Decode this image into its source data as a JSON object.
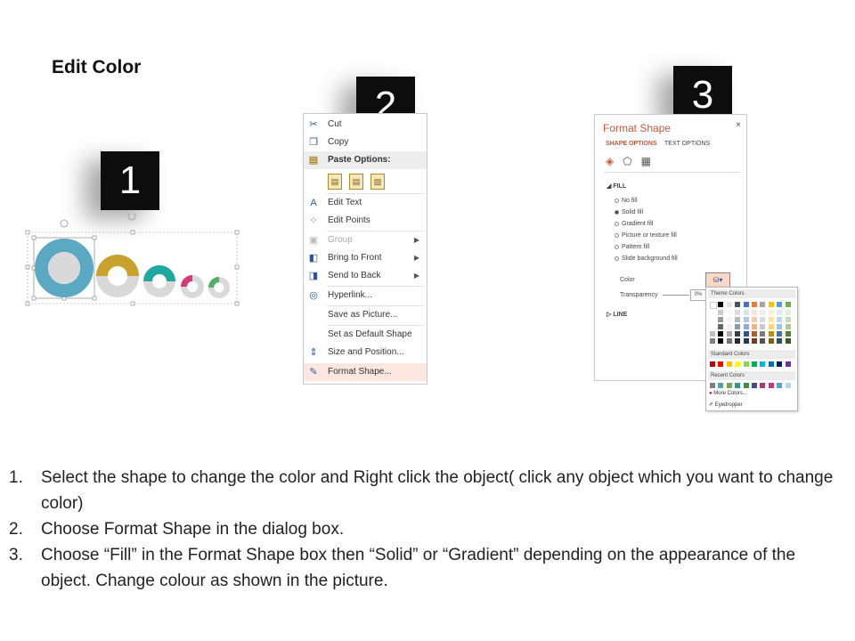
{
  "title": "Edit Color",
  "steps": [
    "1",
    "2",
    "3"
  ],
  "context_menu": {
    "items": [
      {
        "label": "Cut",
        "icon": "scissors-icon",
        "glyph": "✂"
      },
      {
        "label": "Copy",
        "icon": "copy-icon",
        "glyph": "❐"
      },
      {
        "label": "Paste Options:",
        "icon": "paste-icon",
        "glyph": "📋"
      },
      {
        "label": "Edit Text",
        "icon": "edit-text-icon",
        "glyph": "A"
      },
      {
        "label": "Edit Points",
        "icon": "edit-points-icon",
        "glyph": "⁘"
      },
      {
        "label": "Group",
        "icon": "group-icon",
        "glyph": "▣"
      },
      {
        "label": "Bring to Front",
        "icon": "bring-to-front-icon",
        "glyph": "◧"
      },
      {
        "label": "Send to Back",
        "icon": "send-to-back-icon",
        "glyph": "◨"
      },
      {
        "label": "Hyperlink...",
        "icon": "hyperlink-icon",
        "glyph": "🌐"
      },
      {
        "label": "Save as Picture...",
        "icon": "",
        "glyph": ""
      },
      {
        "label": "Set as Default Shape",
        "icon": "",
        "glyph": ""
      },
      {
        "label": "Size and Position...",
        "icon": "size-position-icon",
        "glyph": "⇕"
      },
      {
        "label": "Format Shape...",
        "icon": "format-shape-icon",
        "glyph": "✎"
      }
    ]
  },
  "format_shape": {
    "title": "Format Shape",
    "close": "×",
    "tabs": [
      "SHAPE OPTIONS",
      "TEXT OPTIONS"
    ],
    "fill_header": "FILL",
    "fill_options": [
      "No fill",
      "Solid fill",
      "Gradient fill",
      "Picture or texture fill",
      "Pattern fill",
      "Slide background fill"
    ],
    "selected_option": "Solid fill",
    "color_label": "Color",
    "transparency_label": "Transparency",
    "transparency_value": "0%",
    "line_header": "LINE"
  },
  "color_popup": {
    "theme_colors_label": "Theme Colors",
    "standard_colors_label": "Standard Colors",
    "recent_colors_label": "Recent Colors",
    "more_colors": "More Colors...",
    "eyedropper": "Eyedropper",
    "theme_top": [
      "#ffffff",
      "#000000",
      "#e7e6e6",
      "#44546a",
      "#4472c4",
      "#ed7d31",
      "#a5a5a5",
      "#ffc000",
      "#5b9bd5",
      "#70ad47"
    ],
    "standard": [
      "#c00000",
      "#ff0000",
      "#ffc000",
      "#ffff00",
      "#92d050",
      "#00b050",
      "#00b0f0",
      "#0070c0",
      "#002060",
      "#7030a0"
    ],
    "recent": [
      "#7f7f7f",
      "#4ea6a6",
      "#70ad47",
      "#2e9e8a",
      "#3e8e41",
      "#4a4a8a",
      "#b03a6e",
      "#c8357a",
      "#5aa0c8",
      "#b0d8e8"
    ]
  },
  "shapes": {
    "colors": [
      "#5ba8c2",
      "#c9a22e",
      "#1fa8a0",
      "#d6387a",
      "#4fb06a"
    ],
    "fill_gray": "#d9d9d9"
  },
  "instructions": [
    {
      "num": "1.",
      "text": "Select the shape to change the color and Right click the object( click any object which you want to change color)"
    },
    {
      "num": "2.",
      "text": "Choose Format Shape in the dialog box."
    },
    {
      "num": "3.",
      "text": "Choose “Fill” in the Format Shape box then “Solid” or “Gradient” depending on the appearance of the object. Change colour as shown in the picture."
    }
  ]
}
